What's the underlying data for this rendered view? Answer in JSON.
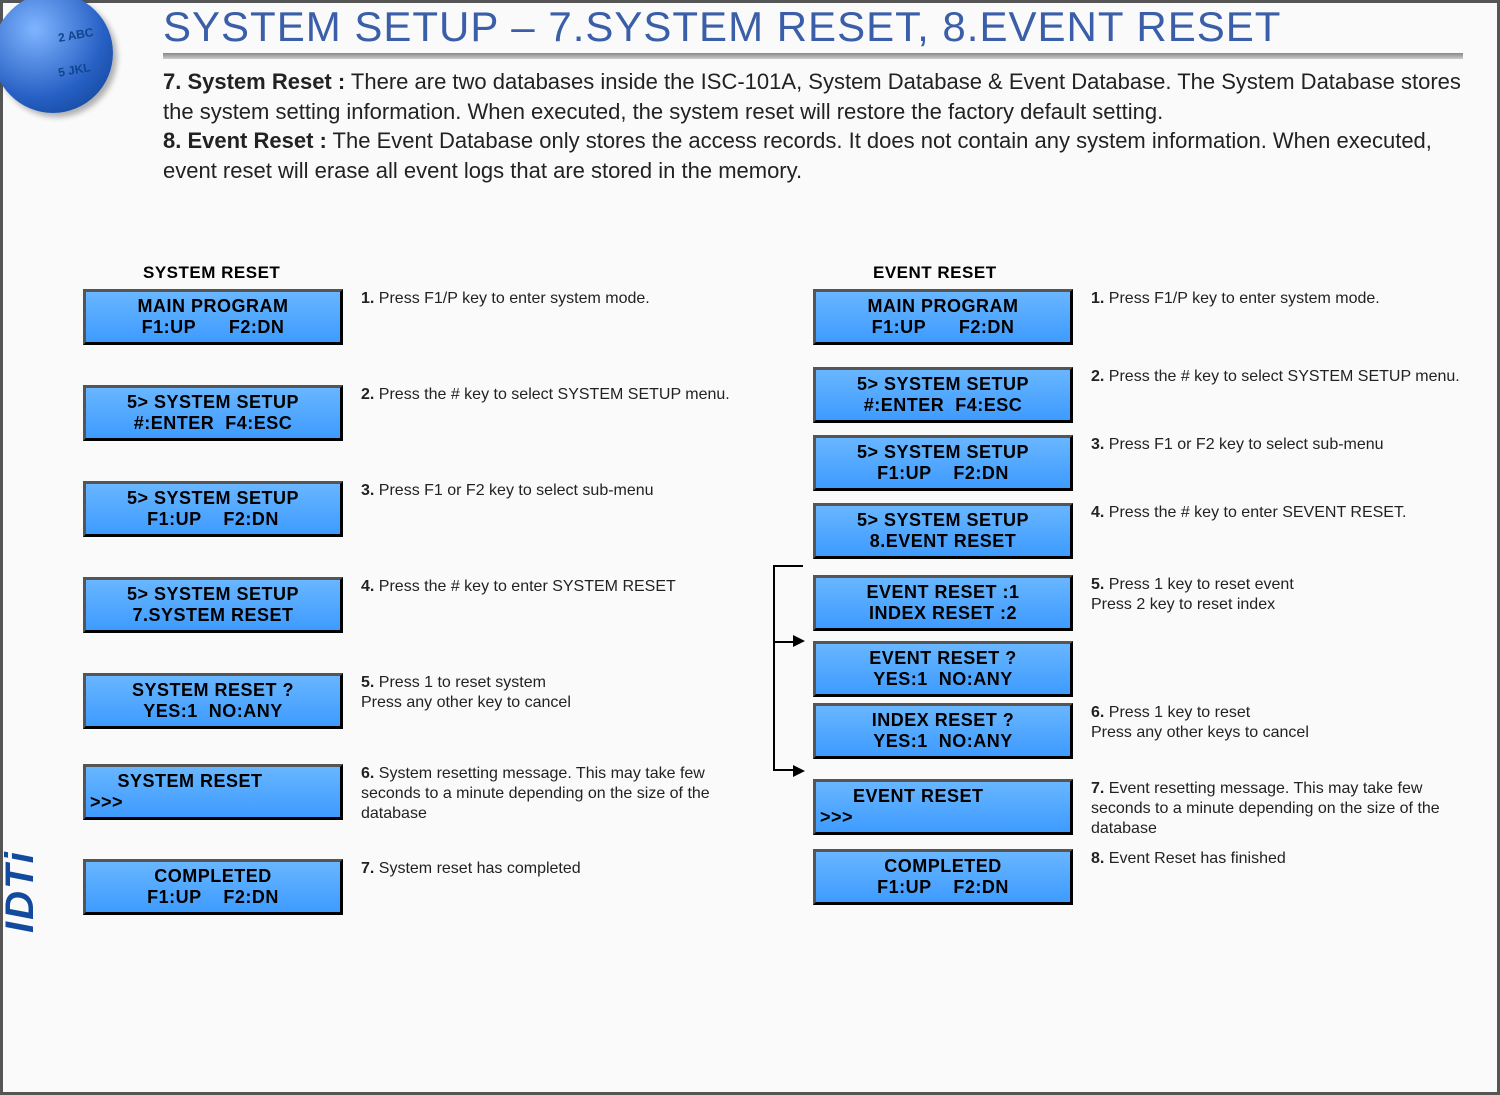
{
  "title": "SYSTEM SETUP – 7.SYSTEM  RESET, 8.EVENT  RESET",
  "disc": {
    "label1": "2 ABC",
    "label2": "5 JKL"
  },
  "brand": "IDTi",
  "desc": {
    "h7": "7. System Reset :",
    "p7": " There are two databases inside the ISC-101A, System Database & Event Database. The System Database stores the system setting information. When executed, the system reset will restore the factory default setting.",
    "h8": "8. Event Reset :",
    "p8": " The Event Database only stores the access records. It does not contain any system information. When executed, event reset will erase all event logs that are stored in the memory."
  },
  "system": {
    "heading": "SYSTEM RESET",
    "steps": [
      {
        "lcd1": "MAIN PROGRAM",
        "lcd2": "F1:UP      F2:DN",
        "n": "1.",
        "txt": " Press F1/P key to enter system mode."
      },
      {
        "lcd1": "5> SYSTEM SETUP",
        "lcd2": "#:ENTER  F4:ESC",
        "n": "2.",
        "txt": " Press the # key to select  SYSTEM SETUP menu."
      },
      {
        "lcd1": "5> SYSTEM SETUP",
        "lcd2": "F1:UP    F2:DN",
        "n": "3.",
        "txt": " Press F1 or F2  key to select sub-menu"
      },
      {
        "lcd1": "5> SYSTEM SETUP",
        "lcd2": "7.SYSTEM RESET",
        "n": "4.",
        "txt": " Press the # key to enter SYSTEM RESET"
      },
      {
        "lcd1": "SYSTEM RESET ?",
        "lcd2": "YES:1  NO:ANY",
        "n": "5.",
        "txt": " Press 1 to reset system\nPress any other key to cancel"
      },
      {
        "lcd1": "     SYSTEM RESET",
        "lcd2": ">>>",
        "n": "6.",
        "txt": " System resetting message. This may take few seconds to a minute depending on the size of the database"
      },
      {
        "lcd1": "COMPLETED",
        "lcd2": "F1:UP    F2:DN",
        "n": "7.",
        "txt": " System reset has completed"
      }
    ]
  },
  "event": {
    "heading": "EVENT RESET",
    "steps": [
      {
        "lcd1": "MAIN PROGRAM",
        "lcd2": "F1:UP      F2:DN",
        "n": "1.",
        "txt": " Press F1/P key to enter system mode."
      },
      {
        "lcd1": "5> SYSTEM SETUP",
        "lcd2": "#:ENTER  F4:ESC",
        "n": "2.",
        "txt": "  Press the # key to select  SYSTEM SETUP menu."
      },
      {
        "lcd1": "5> SYSTEM SETUP",
        "lcd2": "F1:UP    F2:DN",
        "n": "3.",
        "txt": " Press F1 or F2  key to select sub-menu"
      },
      {
        "lcd1": "5> SYSTEM SETUP",
        "lcd2": "8.EVENT RESET",
        "n": "4.",
        "txt": " Press the # key to enter SEVENT RESET."
      },
      {
        "lcd1": "EVENT RESET :1",
        "lcd2": "INDEX RESET :2",
        "n": "5.",
        "txt": " Press 1 key to reset event\nPress 2 key to reset index"
      },
      {
        "lcd1": "EVENT RESET ?",
        "lcd2": "YES:1  NO:ANY",
        "n": "",
        "txt": ""
      },
      {
        "lcd1": "INDEX RESET ?",
        "lcd2": "YES:1  NO:ANY",
        "n": "6.",
        "txt": " Press 1 key to reset\nPress any other keys to cancel"
      },
      {
        "lcd1": "      EVENT RESET",
        "lcd2": ">>>",
        "n": "7.",
        "txt": " Event resetting message. This may take few seconds to a minute depending on the size of the database"
      },
      {
        "lcd1": "COMPLETED",
        "lcd2": "F1:UP    F2:DN",
        "n": "8.",
        "txt": " Event Reset has finished"
      }
    ]
  }
}
